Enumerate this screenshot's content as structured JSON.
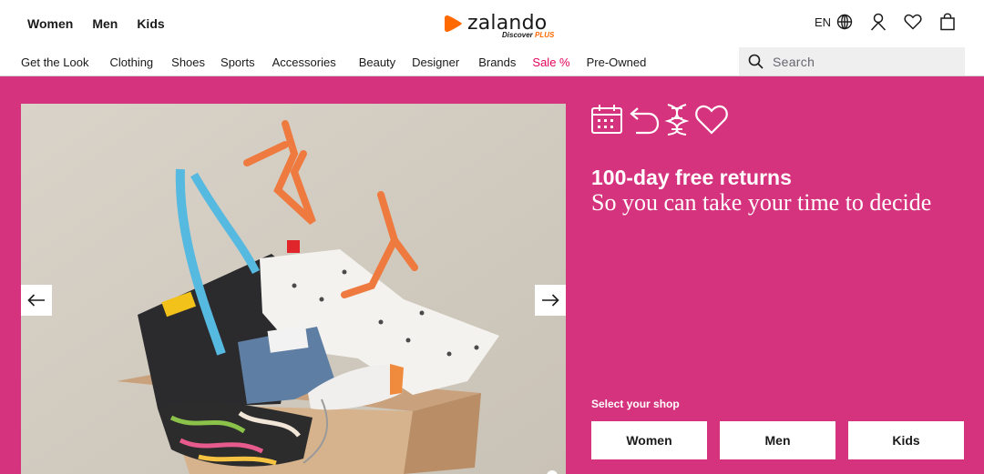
{
  "header": {
    "gender_nav": [
      "Women",
      "Men",
      "Kids"
    ],
    "logo": {
      "word": "zalando",
      "sub_prefix": "Discover",
      "sub_plus": "PLUS"
    },
    "language": "EN",
    "categories": [
      "Get the Look",
      "Clothing",
      "Shoes",
      "Sports",
      "Accessories",
      "Beauty",
      "Designer",
      "Brands",
      "Sale %",
      "Pre-Owned"
    ],
    "search_placeholder": "Search"
  },
  "hero": {
    "promo_title": "100-day free returns",
    "promo_subtitle": "So you can take your time to decide",
    "shop_label": "Select your shop",
    "shop_buttons": [
      "Women",
      "Men",
      "Kids"
    ]
  },
  "colors": {
    "hero_bg": "#d6337e",
    "brand_orange": "#ff6900",
    "sale": "#e5005c",
    "search_bg": "#efeff0"
  },
  "icons": [
    "calendar-icon",
    "return-arrow-icon",
    "dna-icon",
    "heart-icon",
    "globe-icon",
    "user-icon",
    "wishlist-icon",
    "bag-icon",
    "search-icon",
    "arrow-left-icon",
    "arrow-right-icon"
  ]
}
